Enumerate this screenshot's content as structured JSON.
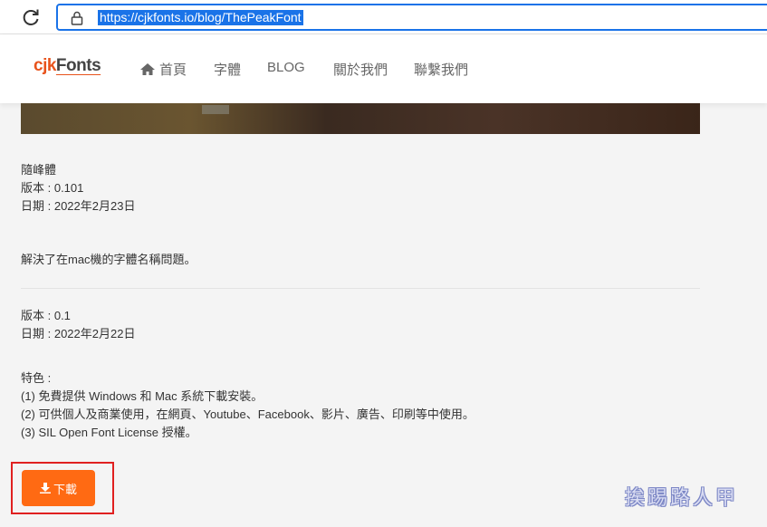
{
  "browser": {
    "url": "https://cjkfonts.io/blog/ThePeakFont"
  },
  "header": {
    "logo_cjk": "cjk",
    "logo_fonts": "Fonts",
    "nav": [
      "首頁",
      "字體",
      "BLOG",
      "關於我們",
      "聯繫我們"
    ]
  },
  "release1": {
    "name": "隨峰體",
    "version": "版本 : 0.101",
    "date": "日期 : 2022年2月23日",
    "note": "解決了在mac機的字體名稱問題。"
  },
  "release2": {
    "version": "版本 : 0.1",
    "date": "日期 : 2022年2月22日",
    "features_title": "特色 :",
    "features": [
      "(1) 免費提供 Windows 和 Mac 系統下載安裝。",
      "(2) 可供個人及商業使用，在網頁、Youtube、Facebook、影片、廣告、印刷等中使用。",
      "(3) SIL Open Font License 授權。"
    ]
  },
  "download": {
    "label": "下載"
  },
  "watermark": "挨踢路人甲",
  "colors": {
    "accent": "#ff6a13",
    "selection": "#1a73e8",
    "highlight": "#e02020"
  }
}
